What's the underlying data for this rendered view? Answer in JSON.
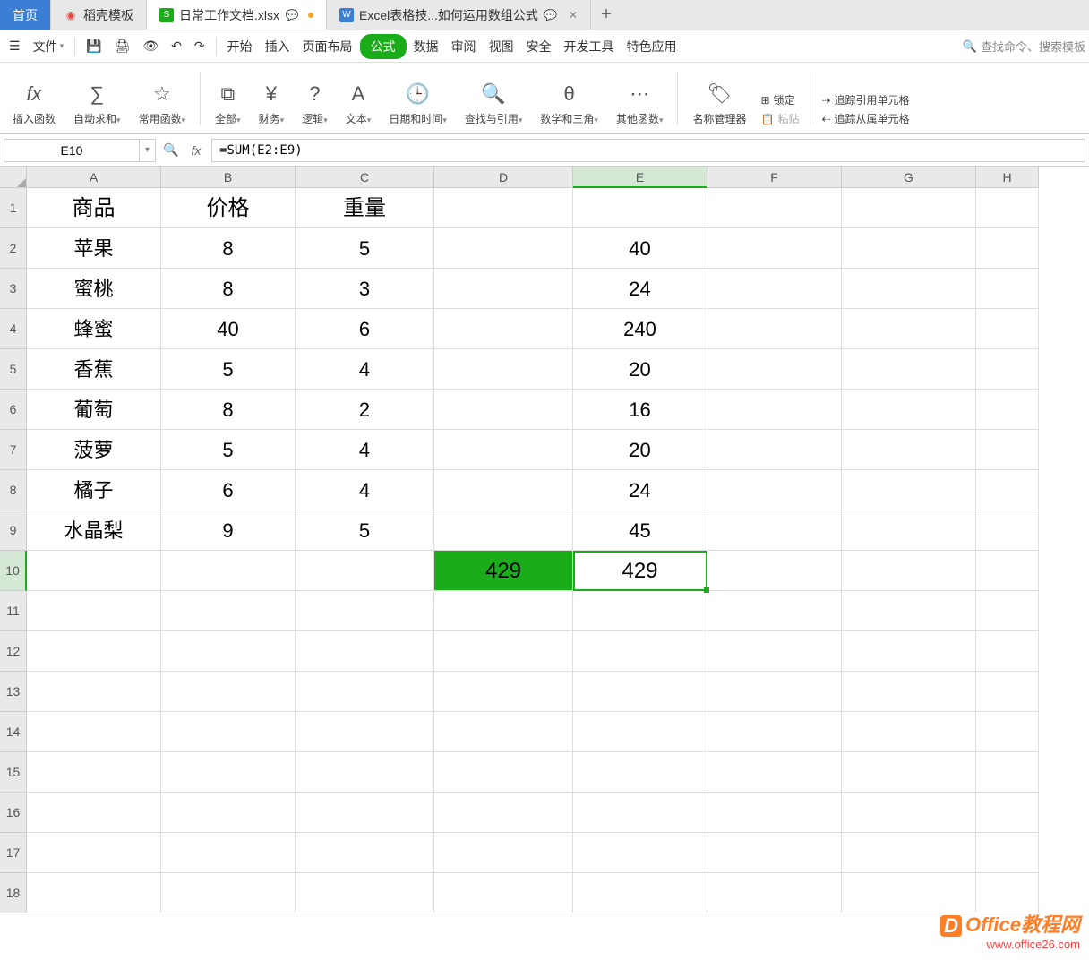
{
  "tabs": {
    "home": "首页",
    "t1": "稻壳模板",
    "t2": "日常工作文档.xlsx",
    "t3": "Excel表格技...如何运用数组公式"
  },
  "menu": {
    "file": "文件",
    "start": "开始",
    "insert": "插入",
    "page": "页面布局",
    "formula": "公式",
    "data": "数据",
    "review": "审阅",
    "view": "视图",
    "security": "安全",
    "dev": "开发工具",
    "special": "特色应用",
    "search": "查找命令、搜索模板"
  },
  "ribbon": {
    "insertfn": "插入函数",
    "autosum": "自动求和",
    "common": "常用函数",
    "all": "全部",
    "finance": "财务",
    "logic": "逻辑",
    "text": "文本",
    "datetime": "日期和时间",
    "lookup": "查找与引用",
    "math": "数学和三角",
    "other": "其他函数",
    "namemgr": "名称管理器",
    "paste": "粘贴",
    "lock": "锁定",
    "traceprec": "追踪引用单元格",
    "tracedep": "追踪从属单元格"
  },
  "fbar": {
    "name": "E10",
    "formula": "=SUM(E2:E9)"
  },
  "cols": [
    "A",
    "B",
    "C",
    "D",
    "E",
    "F",
    "G",
    "H"
  ],
  "rows": [
    "1",
    "2",
    "3",
    "4",
    "5",
    "6",
    "7",
    "8",
    "9",
    "10",
    "11",
    "12",
    "13",
    "14",
    "15",
    "16",
    "17",
    "18"
  ],
  "chart_data": {
    "type": "table",
    "headers": [
      "商品",
      "价格",
      "重量"
    ],
    "selected_cell": "E10",
    "rows": [
      {
        "A": "苹果",
        "B": 8,
        "C": 5,
        "E": 40
      },
      {
        "A": "蜜桃",
        "B": 8,
        "C": 3,
        "E": 24
      },
      {
        "A": "蜂蜜",
        "B": 40,
        "C": 6,
        "E": 240
      },
      {
        "A": "香蕉",
        "B": 5,
        "C": 4,
        "E": 20
      },
      {
        "A": "葡萄",
        "B": 8,
        "C": 2,
        "E": 16
      },
      {
        "A": "菠萝",
        "B": 5,
        "C": 4,
        "E": 20
      },
      {
        "A": "橘子",
        "B": 6,
        "C": 4,
        "E": 24
      },
      {
        "A": "水晶梨",
        "B": 9,
        "C": 5,
        "E": 45
      }
    ],
    "sum_row": {
      "D": 429,
      "E": 429
    }
  },
  "watermark": {
    "line1": "Office教程网",
    "line2": "www.office26.com",
    "badge": "D"
  }
}
